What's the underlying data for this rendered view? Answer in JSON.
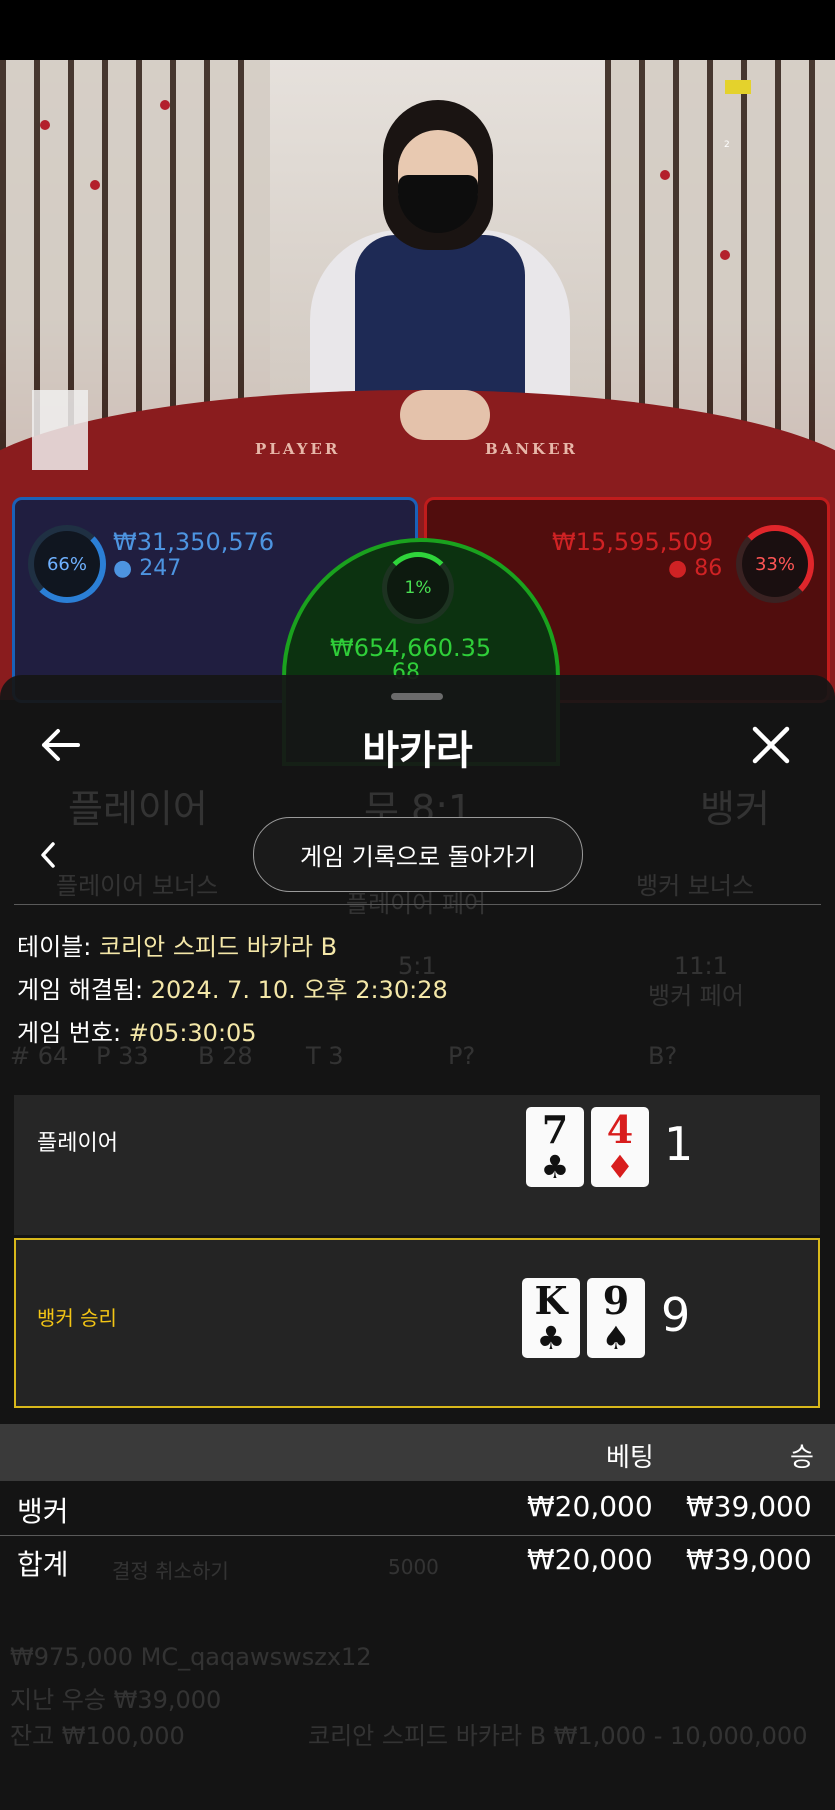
{
  "bet_zones": {
    "player": {
      "percent": "66%",
      "amount": "₩31,350,576",
      "players": "247",
      "color": "#2b7fd6"
    },
    "banker": {
      "percent": "33%",
      "amount": "₩15,595,509",
      "players": "86",
      "color": "#e0262b"
    },
    "tie": {
      "percent": "1%",
      "amount": "₩654,660.35",
      "players": "68",
      "color": "#2fd53b"
    }
  },
  "table_labels": {
    "player": "PLAYER",
    "banker": "BANKER"
  },
  "video_marker": "2",
  "background_ui": {
    "player": "플레이어",
    "tie": "무 8:1",
    "banker": "뱅커",
    "player_bonus": "플레이어 보너스",
    "banker_bonus": "뱅커 보너스",
    "player_pair": "플레이어 페어",
    "banker_pair": "뱅커 페어",
    "pair_odds_p": "5:1",
    "pair_odds_b": "11:1",
    "road_count": "# 64",
    "road_p": "P 33",
    "road_b": "B 28",
    "road_t": "T 3",
    "p_q": "P?",
    "b_q": "B?",
    "balance_line": "₩975,000 MC_qaqawswszx12",
    "last_win": "지난 우승 ₩39,000",
    "balance": "잔고 ₩100,000",
    "table_limits": "코리안 스피드 바카라 B ₩1,000 - 10,000,000",
    "chip": "5000",
    "undo": "결정 취소하기"
  },
  "sheet": {
    "title": "바카라",
    "back_to_history": "게임 기록으로 돌아가기",
    "info": {
      "table_label": "테이블: ",
      "table_value": "코리안 스피드 바카라 B",
      "resolved_label": "게임 해결됨: ",
      "resolved_value": "2024. 7. 10. 오후 2:30:28",
      "game_no_label": "게임 번호: ",
      "game_no_value": "#05:30:05"
    },
    "player_row": {
      "label": "플레이어",
      "cards": [
        {
          "rank": "7",
          "suit": "♣"
        },
        {
          "rank": "4",
          "suit": "♦"
        }
      ],
      "score": "1"
    },
    "banker_row": {
      "label": "뱅커 승리",
      "label_color": "#f3c515",
      "cards": [
        {
          "rank": "K",
          "suit": "♣"
        },
        {
          "rank": "9",
          "suit": "♠"
        }
      ],
      "score": "9"
    },
    "bets_table": {
      "headers": {
        "bet": "베팅",
        "win": "승"
      },
      "rows": [
        {
          "name": "뱅커",
          "bet": "₩20,000",
          "win": "₩39,000"
        },
        {
          "name": "합계",
          "bet": "₩20,000",
          "win": "₩39,000"
        }
      ]
    }
  }
}
